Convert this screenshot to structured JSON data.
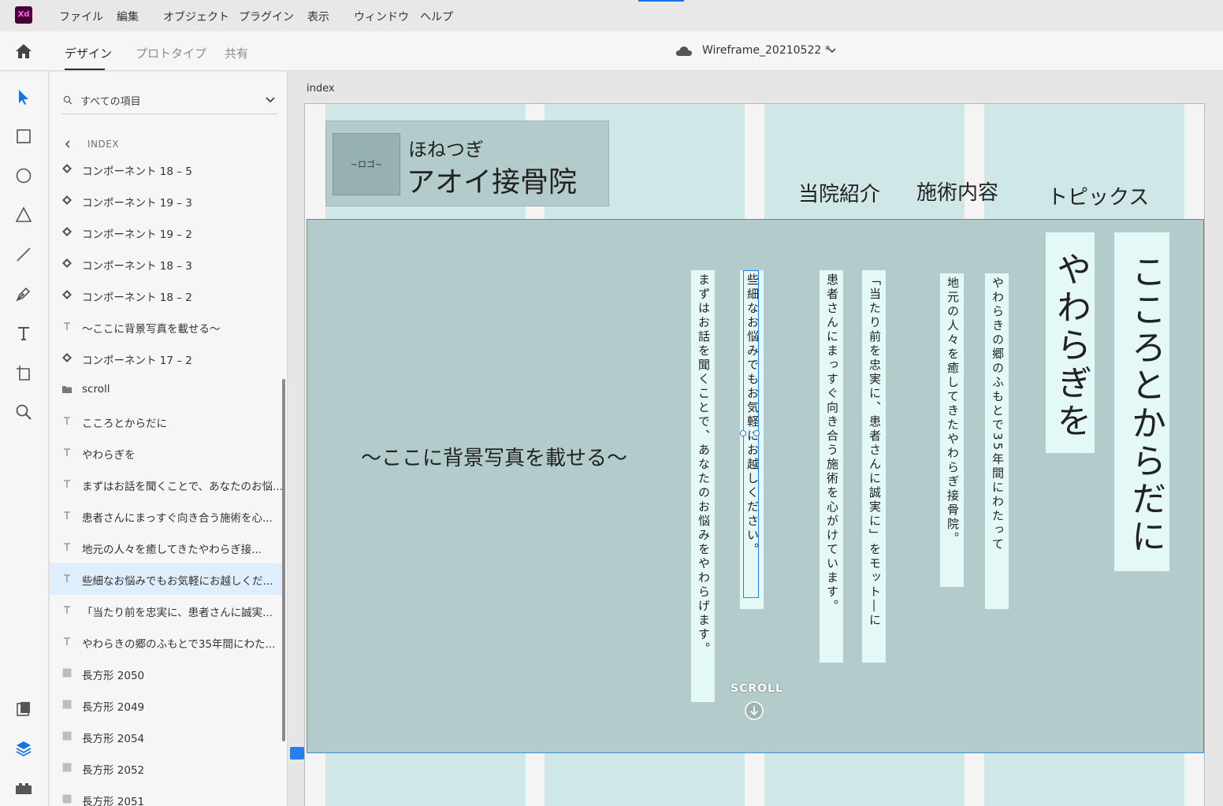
{
  "menubar": {
    "app_logo": "Xd",
    "items": [
      "ファイル",
      "編集",
      "オブジェクト",
      "プラグイン",
      "表示",
      "ウィンドウ",
      "ヘルプ"
    ]
  },
  "toolbar": {
    "tabs": [
      "デザイン",
      "プロトタイプ",
      "共有"
    ],
    "active_tab": "デザイン",
    "doc_title": "Wireframe_20210522 *"
  },
  "tools": [
    "select-icon",
    "rectangle-icon",
    "ellipse-icon",
    "polygon-icon",
    "line-icon",
    "pen-icon",
    "text-icon",
    "artboard-icon",
    "zoom-icon",
    "assets-icon",
    "layers-icon",
    "plugins-icon"
  ],
  "layers": {
    "search_placeholder": "すべての項目",
    "breadcrumb": "INDEX",
    "items": [
      {
        "type": "component",
        "label": "コンポーネント 18 – 5"
      },
      {
        "type": "component",
        "label": "コンポーネント 19 – 3"
      },
      {
        "type": "component",
        "label": "コンポーネント 19 – 2"
      },
      {
        "type": "component",
        "label": "コンポーネント 18 – 3"
      },
      {
        "type": "component",
        "label": "コンポーネント 18 – 2"
      },
      {
        "type": "text",
        "label": "〜ここに背景写真を載せる〜"
      },
      {
        "type": "component",
        "label": "コンポーネント 17 – 2"
      },
      {
        "type": "folder",
        "label": "scroll"
      },
      {
        "type": "text",
        "label": "こころとからだに"
      },
      {
        "type": "text",
        "label": "やわらぎを"
      },
      {
        "type": "text",
        "label": "まずはお話を聞くことで、あなたのお悩..."
      },
      {
        "type": "text",
        "label": "患者さんにまっすぐ向き合う施術を心..."
      },
      {
        "type": "text",
        "label": "地元の人々を癒してきたやわらぎ接..."
      },
      {
        "type": "text",
        "label": "些細なお悩みでもお気軽にお越しくだ...",
        "selected": true
      },
      {
        "type": "text",
        "label": "「当たり前を忠実に、患者さんに誠実..."
      },
      {
        "type": "text",
        "label": "やわらきの郷のふもとで35年間にわた..."
      },
      {
        "type": "rect",
        "label": "長方形 2050"
      },
      {
        "type": "rect",
        "label": "長方形 2049"
      },
      {
        "type": "rect",
        "label": "長方形 2054"
      },
      {
        "type": "rect",
        "label": "長方形 2052"
      },
      {
        "type": "rect",
        "label": "長方形 2051"
      }
    ]
  },
  "artboard": {
    "name": "index",
    "logo_mark": "~ロゴ~",
    "logo_small": "ほねつぎ",
    "logo_name": "アオイ接骨院",
    "nav": [
      "当院紹介",
      "施術内容",
      "トピックス"
    ],
    "hero_bg_text": "〜ここに背景写真を載せる〜",
    "title_line1": "こころとからだに",
    "title_line2": "やわらぎを",
    "body_lines": [
      "やわらきの郷のふもとで35年間にわたって",
      "地元の人々を癒してきたやわらぎ接骨院。",
      "「当たり前を忠実に、患者さんに誠実に」をモット―に",
      "患者さんにまっすぐ向き合う施術を心がけています。",
      "些細なお悩みでもお気軽にお越しください。",
      "まずはお話を聞くことで、あなたのお悩みをやわらげます。"
    ],
    "scroll_label": "SCROLL"
  },
  "colors": {
    "accent": "#1473e6",
    "column": "#cfe7e6",
    "hero": "#b3cccb",
    "text_box": "#e4f8f8",
    "selection": "#2680eb"
  }
}
